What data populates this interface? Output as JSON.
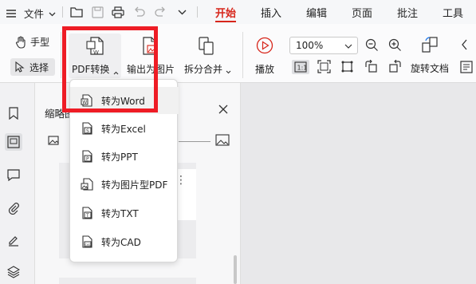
{
  "menubar": {
    "file_label": "文件",
    "tabs": [
      "开始",
      "插入",
      "编辑",
      "页面",
      "批注",
      "工具"
    ],
    "active_tab": "开始"
  },
  "ribbon": {
    "hand_tool": "手型",
    "select_tool": "选择",
    "pdf_convert": "PDF转换",
    "export_image": "输出为图片",
    "split_merge": "拆分合并",
    "play": "播放",
    "zoom_value": "100%",
    "rotate_doc": "旋转文档"
  },
  "thumbnail_panel": {
    "title": "缩略图"
  },
  "convert_menu": {
    "items": [
      "转为Word",
      "转为Excel",
      "转为PPT",
      "转为图片型PDF",
      "转为TXT",
      "转为CAD"
    ]
  },
  "colors": {
    "accent": "#d7261b",
    "highlight": "#ee1c25"
  }
}
